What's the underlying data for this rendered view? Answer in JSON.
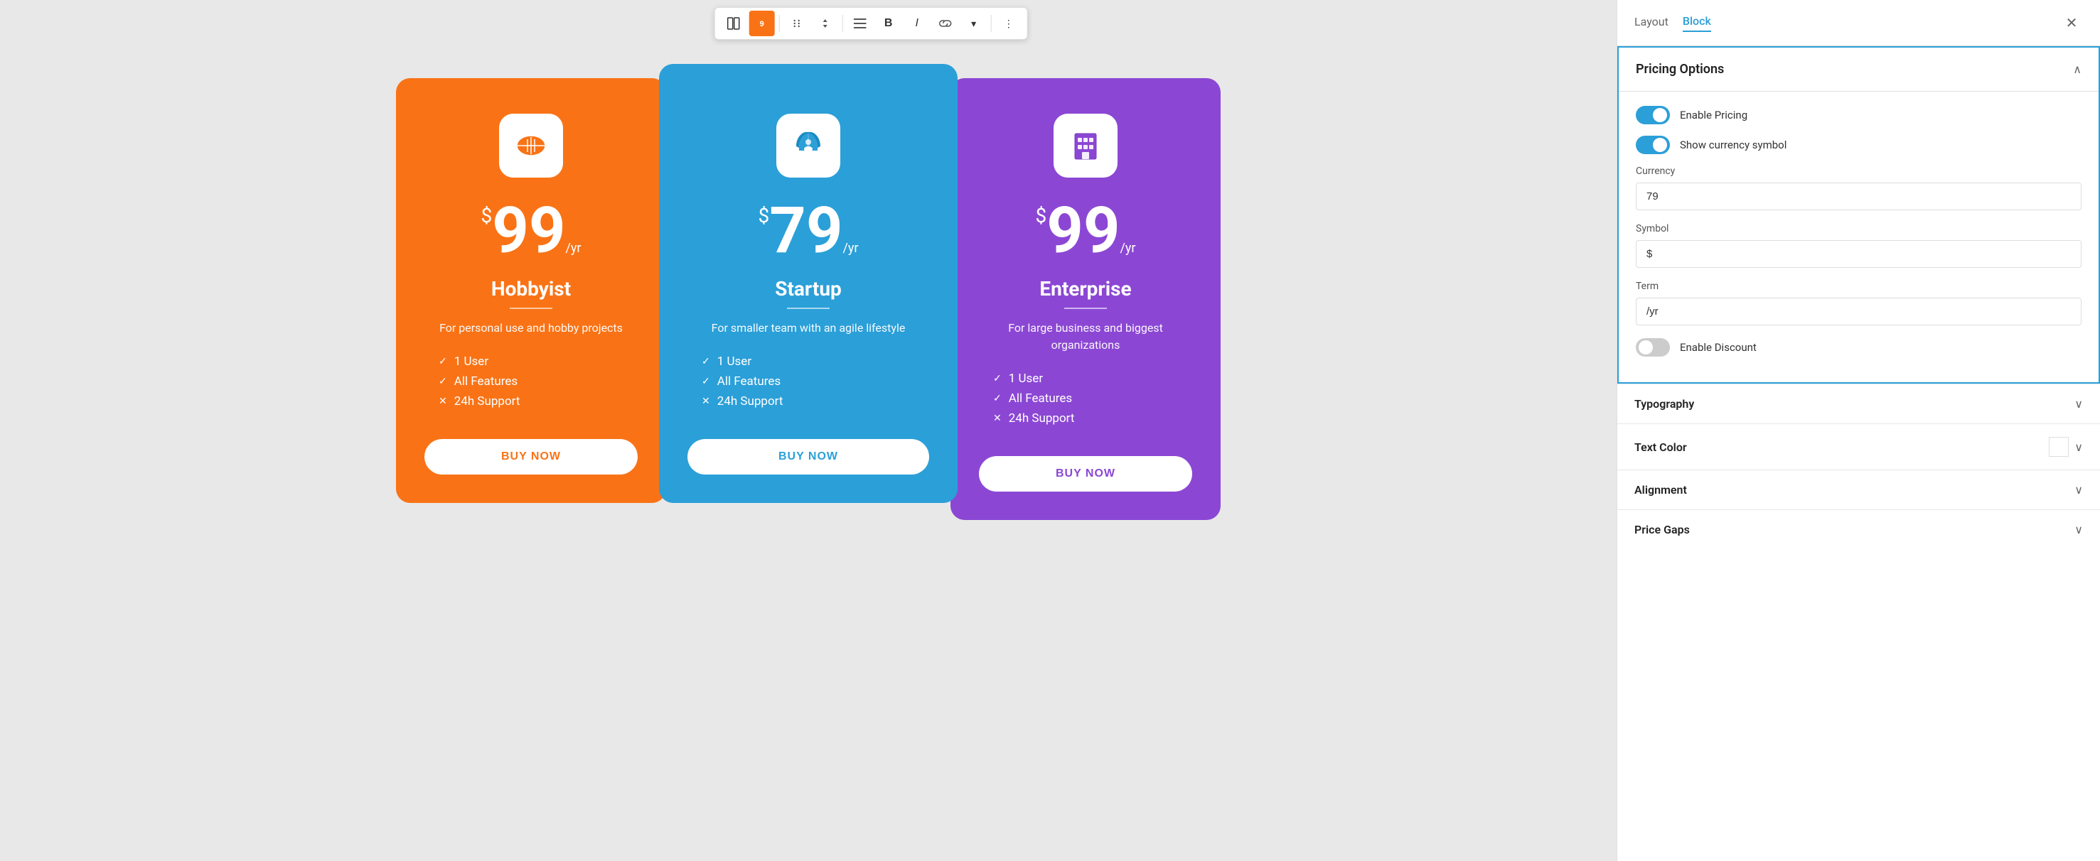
{
  "toolbar": {
    "buttons": [
      {
        "id": "layout-icon",
        "label": "⬜",
        "active": false
      },
      {
        "id": "block-icon",
        "label": "🟧",
        "active": true
      },
      {
        "id": "drag-icon",
        "label": "⠿",
        "active": false
      },
      {
        "id": "arrow-icon",
        "label": "⇅",
        "active": false
      },
      {
        "id": "align-icon",
        "label": "☰",
        "active": false
      },
      {
        "id": "bold-icon",
        "label": "B",
        "active": false
      },
      {
        "id": "italic-icon",
        "label": "I",
        "active": false
      },
      {
        "id": "link-icon",
        "label": "⇆",
        "active": false
      },
      {
        "id": "dropdown-icon",
        "label": "▾",
        "active": false
      },
      {
        "id": "more-icon",
        "label": "⋮",
        "active": false
      }
    ]
  },
  "cards": [
    {
      "id": "hobbyist",
      "icon": "football",
      "price_symbol": "$",
      "price": "99",
      "term": "/yr",
      "name": "Hobbyist",
      "description": "For personal use and hobby projects",
      "features": [
        {
          "text": "1 User",
          "included": true
        },
        {
          "text": "All Features",
          "included": true
        },
        {
          "text": "24h Support",
          "included": false
        }
      ],
      "button_label": "BUY NOW",
      "color": "#f97316"
    },
    {
      "id": "startup",
      "icon": "rocket",
      "price_symbol": "$",
      "price": "79",
      "term": "/yr",
      "name": "Startup",
      "description": "For smaller team with an agile lifestyle",
      "features": [
        {
          "text": "1 User",
          "included": true
        },
        {
          "text": "All Features",
          "included": true
        },
        {
          "text": "24h Support",
          "included": false
        }
      ],
      "button_label": "BUY NOW",
      "color": "#2b9fd8"
    },
    {
      "id": "enterprise",
      "icon": "building",
      "price_symbol": "$",
      "price": "99",
      "term": "/yr",
      "name": "Enterprise",
      "description": "For large business and biggest organizations",
      "features": [
        {
          "text": "1 User",
          "included": true
        },
        {
          "text": "All Features",
          "included": true
        },
        {
          "text": "24h Support",
          "included": false
        }
      ],
      "button_label": "BUY NOW",
      "color": "#8b47d4"
    }
  ],
  "panel": {
    "tabs": [
      {
        "id": "layout",
        "label": "Layout"
      },
      {
        "id": "block",
        "label": "Block"
      }
    ],
    "active_tab": "block",
    "close_label": "✕",
    "sections": {
      "pricing_options": {
        "title": "Pricing Options",
        "enable_pricing_label": "Enable Pricing",
        "enable_pricing": true,
        "show_currency_label": "Show currency symbol",
        "show_currency": true,
        "currency_label": "Currency",
        "currency_value": "79",
        "symbol_label": "Symbol",
        "symbol_value": "$",
        "term_label": "Term",
        "term_value": "/yr",
        "enable_discount_label": "Enable Discount",
        "enable_discount": false
      },
      "typography": {
        "title": "Typography"
      },
      "text_color": {
        "title": "Text Color"
      },
      "alignment": {
        "title": "Alignment"
      },
      "price_gaps": {
        "title": "Price Gaps"
      }
    }
  }
}
